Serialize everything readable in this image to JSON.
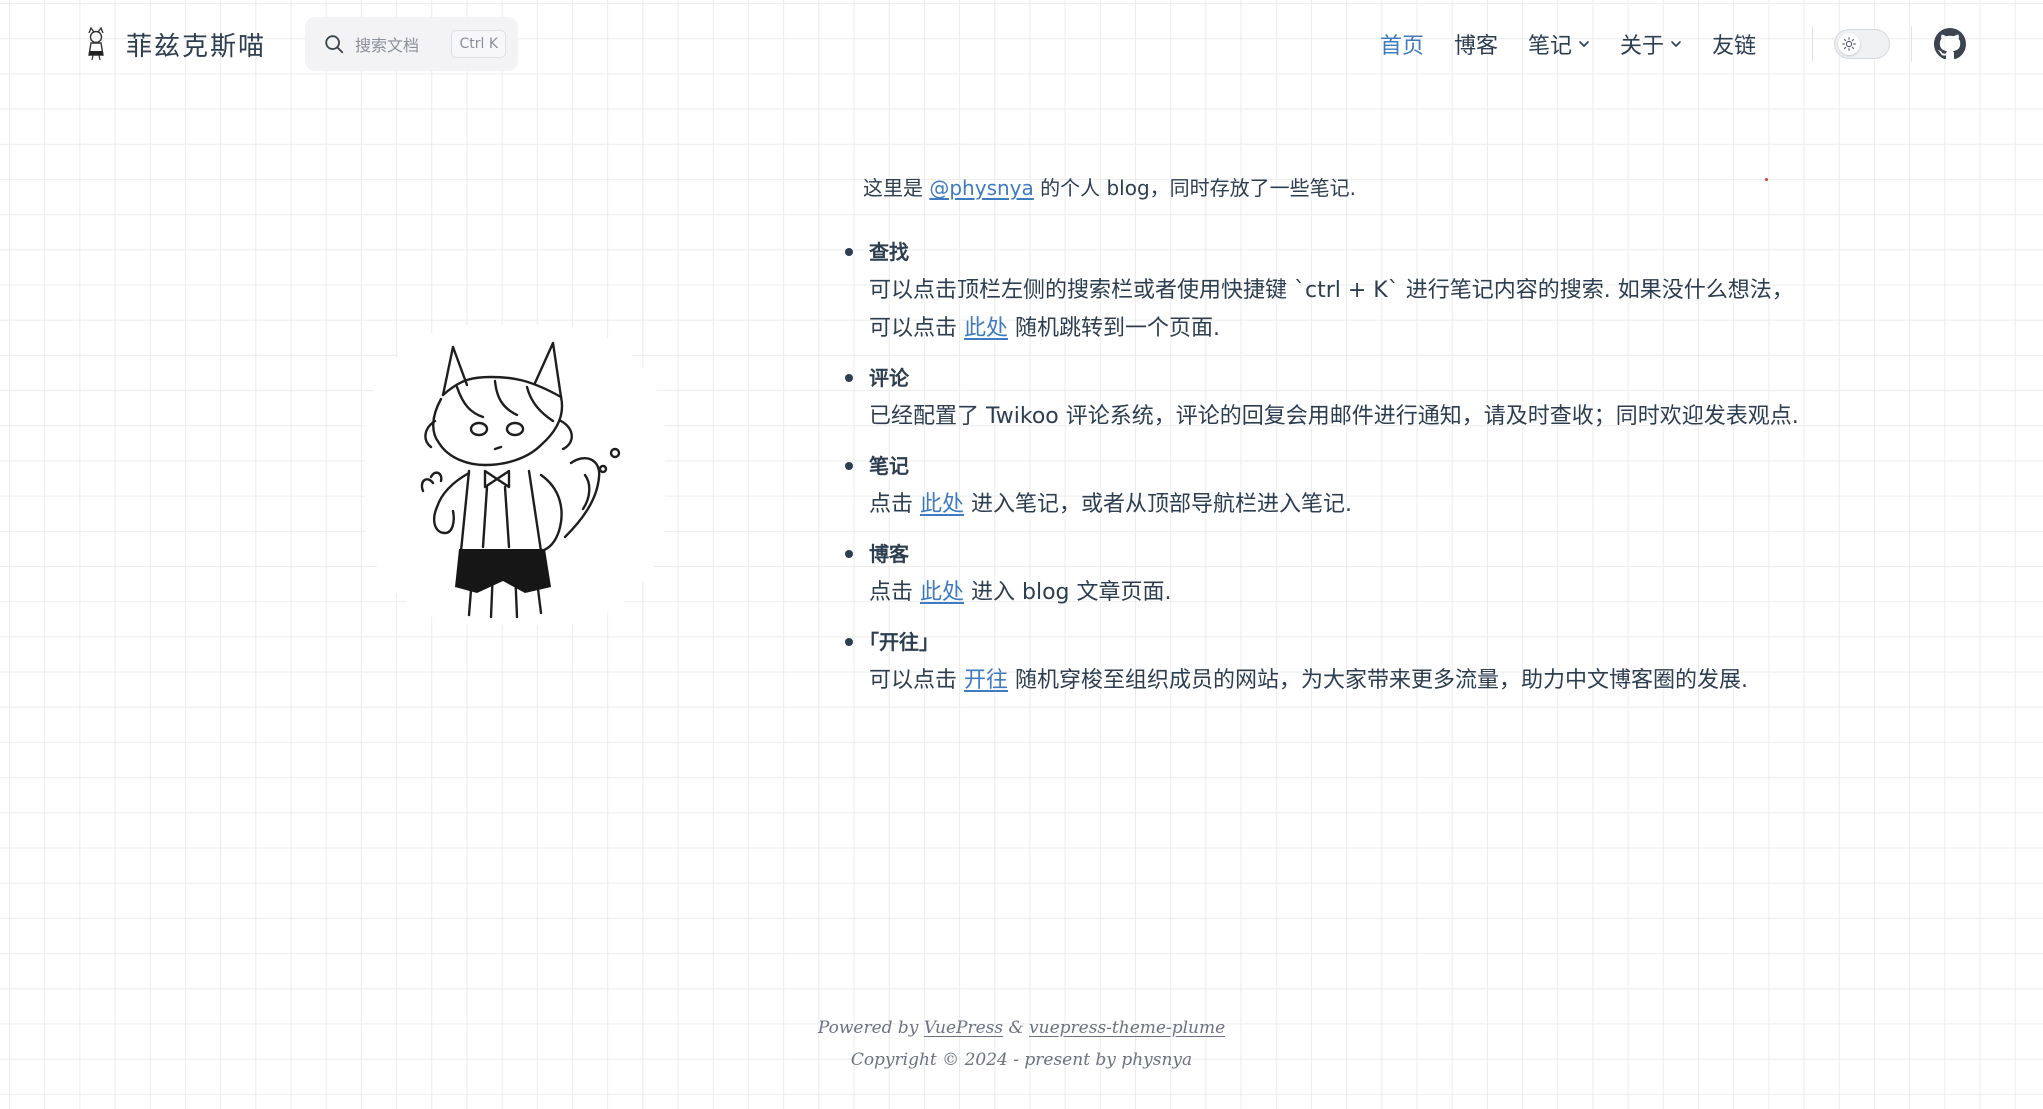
{
  "navbar": {
    "site_title": "菲兹克斯喵",
    "logo_icon": "cat-logo-icon",
    "search": {
      "placeholder": "搜索文档",
      "shortcut": "Ctrl K"
    },
    "links": [
      {
        "label": "首页",
        "active": true
      },
      {
        "label": "博客"
      },
      {
        "label": "笔记",
        "dropdown": true
      },
      {
        "label": "关于",
        "dropdown": true
      },
      {
        "label": "友链"
      }
    ],
    "theme_toggle_icon": "sun-icon",
    "repo_icon": "github-icon"
  },
  "hero": {
    "avatar_icon": "cat-girl-sketch"
  },
  "content": {
    "intro": {
      "prefix": "这里是 ",
      "link": "@physnya",
      "suffix": " 的个人 blog，同时存放了一些笔记."
    },
    "features": [
      {
        "title": "查找",
        "text_before": "可以点击顶栏左侧的搜索栏或者使用快捷键 `ctrl + K` 进行笔记内容的搜索. 如果没什么想法，可以点击 ",
        "link": "此处",
        "text_after": " 随机跳转到一个页面."
      },
      {
        "title": "评论",
        "text_before": "已经配置了 Twikoo 评论系统，评论的回复会用邮件进行通知，请及时查收；同时欢迎发表观点.",
        "link": "",
        "text_after": ""
      },
      {
        "title": "笔记",
        "text_before": "点击 ",
        "link": "此处",
        "text_after": " 进入笔记，或者从顶部导航栏进入笔记."
      },
      {
        "title": "博客",
        "text_before": "点击 ",
        "link": "此处",
        "text_after": " 进入 blog 文章页面."
      },
      {
        "title": "｢开往｣",
        "text_before": "可以点击 ",
        "link": "开往",
        "text_after": " 随机穿梭至组织成员的网站，为大家带来更多流量，助力中文博客圈的发展."
      }
    ]
  },
  "footer": {
    "powered_prefix": "Powered by ",
    "vuepress_link": "VuePress",
    "ampersand": " & ",
    "theme_link": "vuepress-theme-plume",
    "copyright": "Copyright © 2024 - present by physnya"
  },
  "colors": {
    "accent": "#3e7bbf",
    "text": "#2c3e50",
    "grid": "#ececec"
  }
}
